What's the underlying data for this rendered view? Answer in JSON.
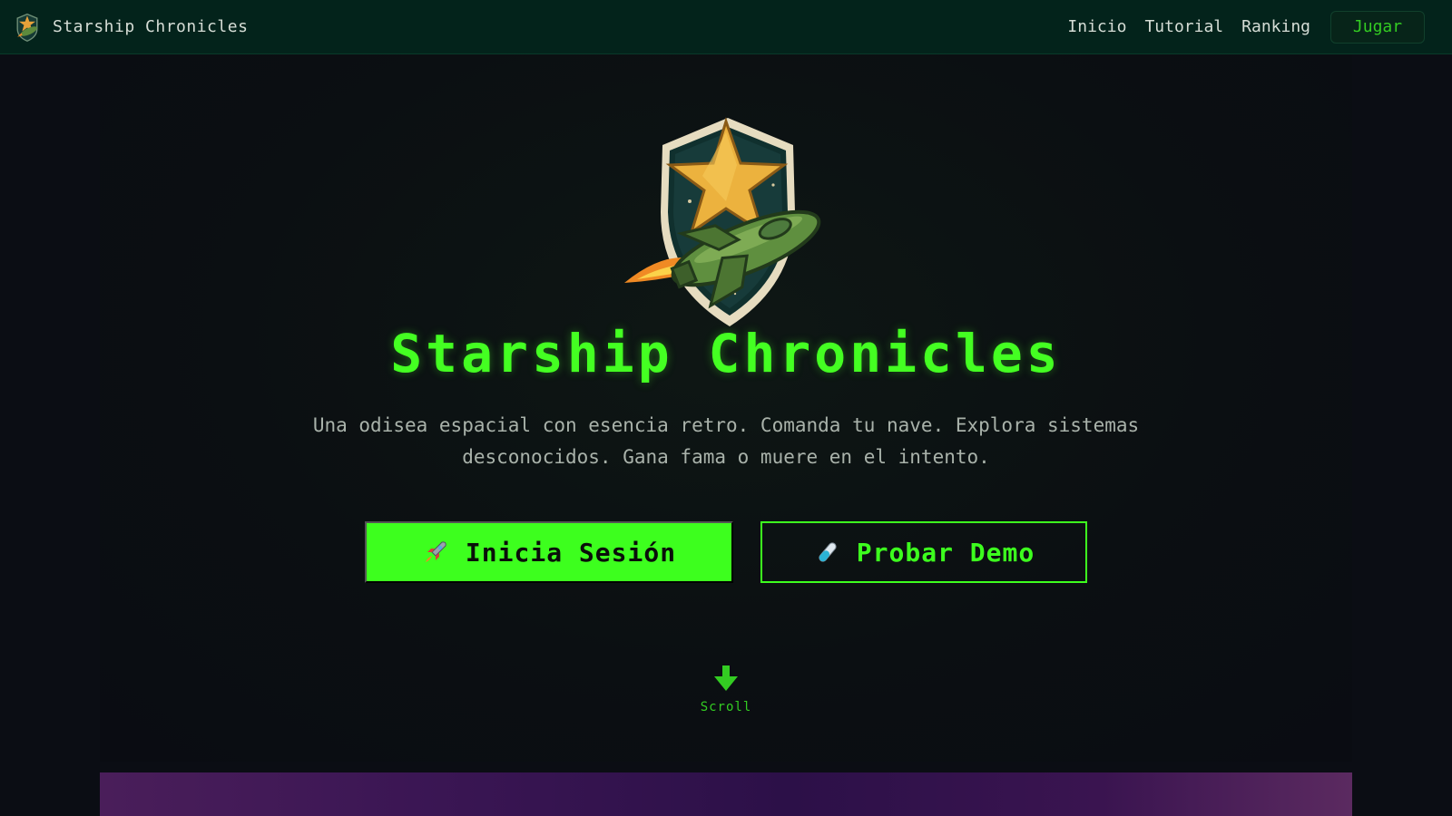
{
  "header": {
    "brand_name": "Starship Chronicles",
    "nav": [
      "Inicio",
      "Tutorial",
      "Ranking"
    ],
    "cta_label": "Jugar"
  },
  "hero": {
    "title": "Starship Chronicles",
    "description": "Una odisea espacial con esencia retro. Comanda tu nave. Explora sistemas desconocidos. Gana fama o muere en el intento.",
    "primary_button": {
      "label": "Inicia Sesión",
      "icon": "rocket-icon"
    },
    "secondary_button": {
      "label": "Probar Demo",
      "icon": "test-tube-icon"
    }
  },
  "scroll": {
    "label": "Scroll",
    "icon": "arrow-down-icon"
  },
  "colors": {
    "accent": "#3dff1e",
    "header_bg": "#03231b",
    "page_bg": "#0b0d14"
  }
}
